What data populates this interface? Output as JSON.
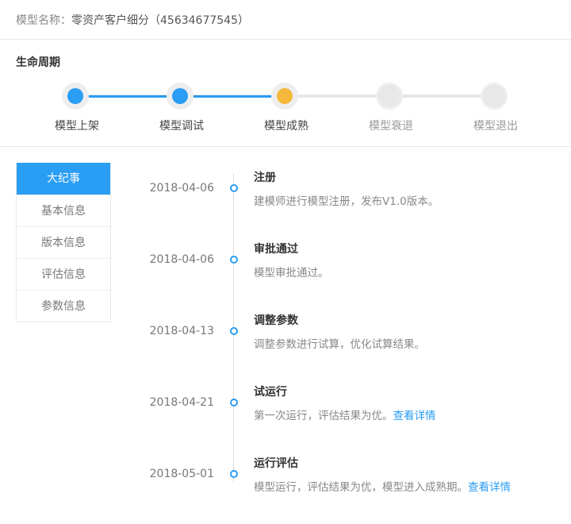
{
  "header": {
    "model_name_label": "模型名称：",
    "model_name_value": "零资产客户细分（45634677545）"
  },
  "lifecycle": {
    "title": "生命周期",
    "stages": [
      {
        "label": "模型上架",
        "status": "done"
      },
      {
        "label": "模型调试",
        "status": "done"
      },
      {
        "label": "模型成熟",
        "status": "current"
      },
      {
        "label": "模型衰退",
        "status": "future"
      },
      {
        "label": "模型退出",
        "status": "future"
      }
    ],
    "colors": {
      "done": "#2a9df4",
      "current": "#f5b83b",
      "future": "#e8e8e8"
    }
  },
  "tabs": [
    {
      "label": "大纪事",
      "active": true
    },
    {
      "label": "基本信息",
      "active": false
    },
    {
      "label": "版本信息",
      "active": false
    },
    {
      "label": "评估信息",
      "active": false
    },
    {
      "label": "参数信息",
      "active": false
    }
  ],
  "timeline": [
    {
      "date": "2018-04-06",
      "title": "注册",
      "desc": "建模师进行模型注册，发布V1.0版本。",
      "link": ""
    },
    {
      "date": "2018-04-06",
      "title": "审批通过",
      "desc": "模型审批通过。",
      "link": ""
    },
    {
      "date": "2018-04-13",
      "title": "调整参数",
      "desc": "调整参数进行试算，优化试算结果。",
      "link": ""
    },
    {
      "date": "2018-04-21",
      "title": "试运行",
      "desc": "第一次运行，评估结果为优。",
      "link": "查看详情"
    },
    {
      "date": "2018-05-01",
      "title": "运行评估",
      "desc": "模型运行，评估结果为优，模型进入成熟期。",
      "link": "查看详情"
    }
  ],
  "accent_color": "#2a9df4"
}
